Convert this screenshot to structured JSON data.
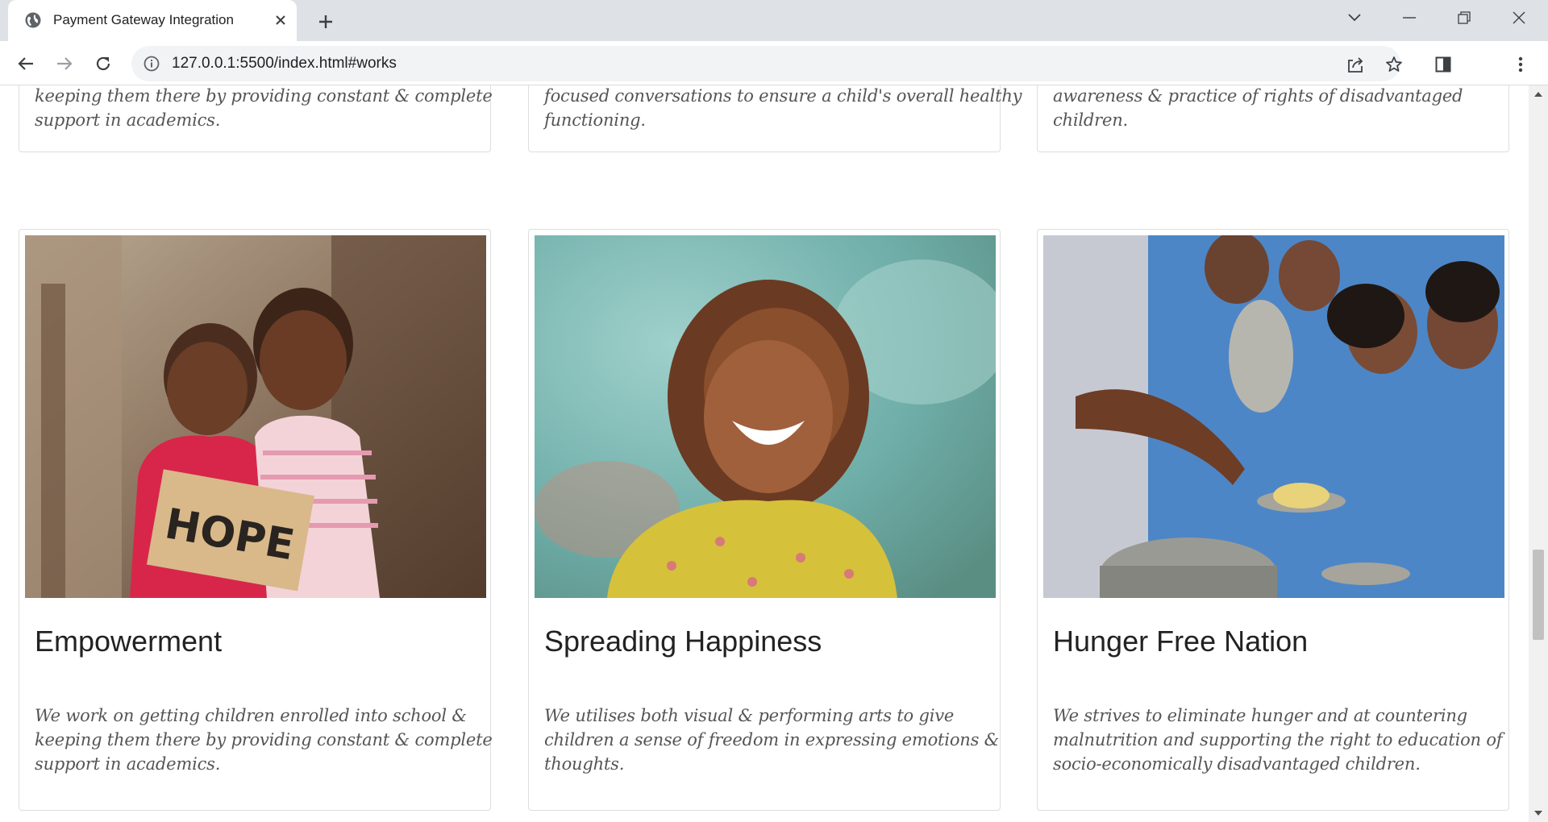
{
  "browser": {
    "tab_title": "Payment Gateway Integration",
    "url": "127.0.0.1:5500/index.html#works"
  },
  "works": {
    "top_row": [
      {
        "line1": "keeping them there by providing constant & complete",
        "line2": "support in academics."
      },
      {
        "line1": "focused conversations to ensure a child's overall healthy",
        "line2": "functioning."
      },
      {
        "line1": "awareness & practice of rights of disadvantaged",
        "line2": "children."
      }
    ],
    "cards": [
      {
        "title": "Empowerment",
        "image_alt": "Two smiling girls holding a HOPE sign",
        "sign_text": "HOPE",
        "desc_lines": [
          "We work on getting children enrolled into school &",
          "keeping them there by providing constant & complete",
          "support in academics."
        ]
      },
      {
        "title": "Spreading Happiness",
        "image_alt": "Smiling girl in a yellow dress",
        "desc_lines": [
          "We utilises both visual & performing arts to give",
          "children a sense of freedom in expressing emotions &",
          "thoughts."
        ]
      },
      {
        "title": "Hunger Free Nation",
        "image_alt": "Children in blue uniforms receiving a meal",
        "desc_lines": [
          "We strives to eliminate hunger and at countering",
          "malnutrition and supporting the right to education of",
          "socio-economically disadvantaged children."
        ]
      }
    ]
  },
  "scroll_position": 0.64
}
